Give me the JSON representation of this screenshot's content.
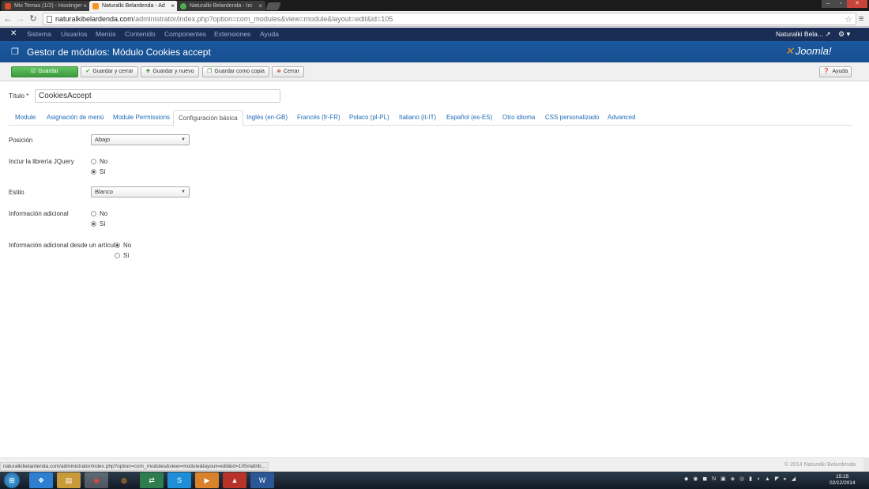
{
  "browser": {
    "tabs": [
      {
        "label": "Mis Temas (1/2) - Hostinger",
        "favicon_color": "#d44a2a"
      },
      {
        "label": "Naturalki Belardenda - Ad",
        "favicon_color": "#f7941d"
      },
      {
        "label": "Naturalki Belardenda - Ini",
        "favicon_color": "#4caf50"
      }
    ],
    "tab_close": "×",
    "url_domain": "naturalkibelardenda.com",
    "url_path": "/administrator/index.php?option=com_modules&view=module&layout=edit&id=105",
    "status_url": "naturalkibelardenda.com/administrator/index.php?option=com_modules&view=module&layout=edit&id=105#attrib..."
  },
  "jnav": {
    "menu": [
      "Sistema",
      "Usuarios",
      "Menús",
      "Contenido",
      "Componentes",
      "Extensiones",
      "Ayuda"
    ],
    "site_name": "Naturalki Bela...",
    "site_icon": "↗",
    "gear": "⚙ ▾"
  },
  "header": {
    "title": "Gestor de módulos: Módulo Cookies accept",
    "brand": "Joomla!",
    "brand_mark": "✕"
  },
  "toolbar": {
    "save": "Guardar",
    "save_close": "Guardar y cerrar",
    "save_new": "Guardar y nuevo",
    "save_copy": "Guardar como copia",
    "close": "Cerrar",
    "help": "Ayuda"
  },
  "form": {
    "title_label": "Título",
    "required_mark": "*",
    "title_value": "CookiesAccept",
    "tabs": [
      "Module",
      "Asignación de menú",
      "Module Permissions",
      "Configuración básica",
      "Inglés (en-GB)",
      "Francés (fr-FR)",
      "Polaco (pl-PL)",
      "Italiano (it-IT)",
      "Español (es-ES)",
      "Otro idioma",
      "CSS personalizado",
      "Advanced"
    ],
    "active_tab": "Configuración básica",
    "position": {
      "label": "Posición",
      "value": "Abajo"
    },
    "jquery": {
      "label": "Inclur la librería JQuery",
      "options": [
        "No",
        "Sí"
      ],
      "selected": "Sí"
    },
    "style": {
      "label": "Estilo",
      "value": "Blanco"
    },
    "info": {
      "label": "Información adicional",
      "options": [
        "No",
        "Sí"
      ],
      "selected": "Sí"
    },
    "info_article": {
      "label": "Información adicional desde un artículo",
      "options": [
        "No",
        "Sí"
      ],
      "selected": "No"
    }
  },
  "footer": {
    "copyright": "© 2014 Naturalki Belardenda"
  },
  "taskbar": {
    "apps": [
      "dropbox-icon",
      "explorer-icon",
      "chrome-icon",
      "firefox-icon",
      "network-icon",
      "skype-icon",
      "media-icon",
      "filezilla-icon",
      "word-icon"
    ],
    "time": "15:15",
    "date": "02/12/2014"
  },
  "colors": {
    "joomla_nav": "#1a2d54",
    "joomla_header": "#1a58a0",
    "save_green": "#46a546",
    "link_blue": "#1f6bb5"
  }
}
